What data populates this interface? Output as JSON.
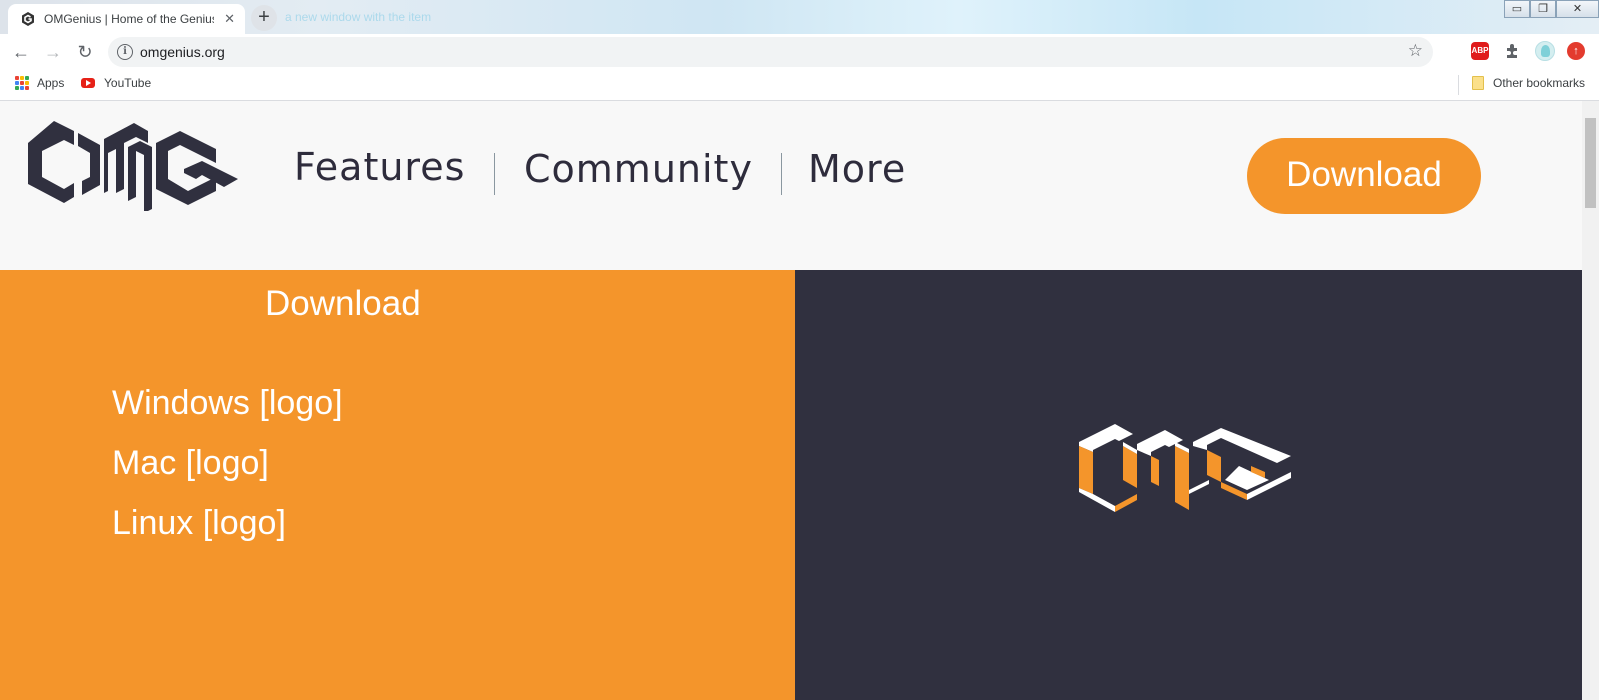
{
  "browser": {
    "tab_title": "OMGenius | Home of the Genius",
    "tab_close": "✕",
    "new_tab": "+",
    "ghost_tab": "a new window with the item",
    "url": "omgenius.org",
    "back": "←",
    "forward": "→",
    "reload": "↻",
    "star": "☆",
    "window_controls": {
      "minimize": "▭",
      "restore": "❐",
      "close": "✕"
    },
    "extensions": [
      {
        "name": "adblock-plus-icon",
        "label": "ABP",
        "color": "#e01b1b"
      },
      {
        "name": "puzzle-extensions-icon",
        "label": "",
        "color": "#5f6368"
      },
      {
        "name": "profile-avatar-icon",
        "label": "",
        "color": "#7fd0d8"
      },
      {
        "name": "update-icon",
        "label": "",
        "color": "#e33b2e"
      }
    ]
  },
  "bookmarks": {
    "apps": "Apps",
    "youtube": "YouTube",
    "other": "Other bookmarks"
  },
  "header": {
    "nav": [
      "Features",
      "Community",
      "More"
    ],
    "download_button": "Download"
  },
  "download_panel": {
    "title": "Download",
    "options": [
      "Windows [logo]",
      "Mac [logo]",
      "Linux [logo]"
    ]
  },
  "colors": {
    "brand_orange": "#f4952b",
    "brand_dark": "#30303f",
    "header_bg": "#f8f8f8"
  }
}
